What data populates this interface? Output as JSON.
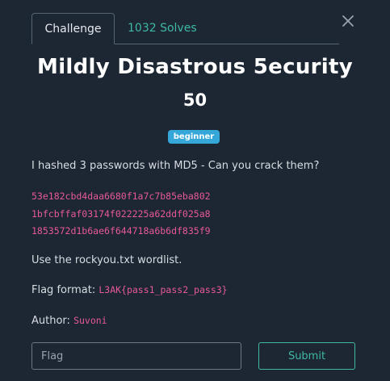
{
  "tabs": {
    "challenge": "Challenge",
    "solves": "1032 Solves"
  },
  "challenge": {
    "title": "Mildly Disastrous 5ecurity",
    "points": "50",
    "tag": "beginner",
    "description": "I hashed 3 passwords with MD5 - Can you crack them?",
    "hashes": [
      "53e182cbd4daa6680f1a7c7b85eba802",
      "1bfcbffaf03174f022225a62ddf025a8",
      "1853572d1b6ae6f644718a6b6df835f9"
    ],
    "wordlist_note": "Use the rockyou.txt wordlist.",
    "flag_format_label": "Flag format:",
    "flag_format_value": "L3AK{pass1_pass2_pass3}",
    "author_label": "Author:",
    "author_name": "Suvoni"
  },
  "form": {
    "flag_placeholder": "Flag",
    "submit_label": "Submit"
  },
  "colors": {
    "background": "#1c2733",
    "accent": "#3fb8a4",
    "code": "#e8589a",
    "badge": "#35a8d9"
  },
  "icons": {
    "close": "close-icon"
  }
}
